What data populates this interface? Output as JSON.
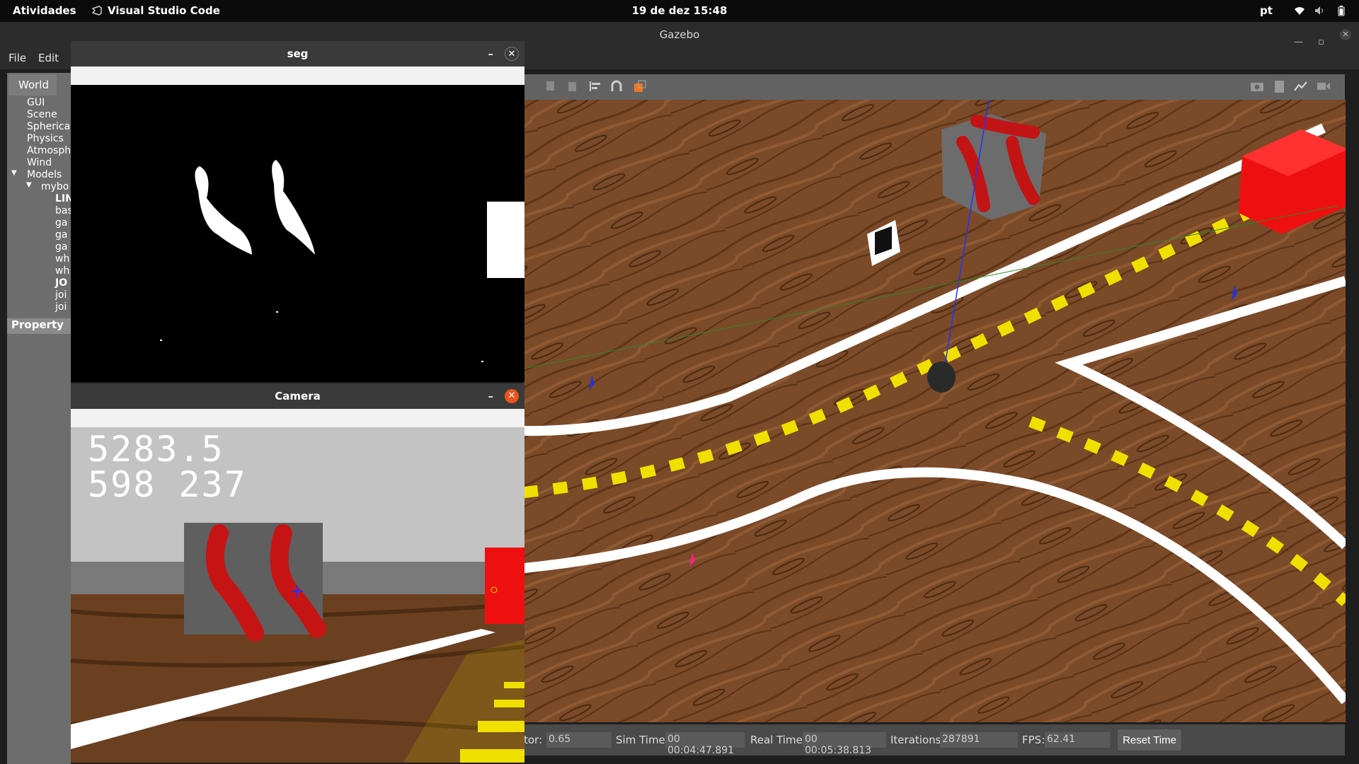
{
  "topbar": {
    "activities": "Atividades",
    "app_name": "Visual Studio Code",
    "clock": "19 de dez  15:48",
    "language": "pt",
    "icons": [
      "wifi-icon",
      "volume-icon",
      "battery-icon"
    ]
  },
  "gazebo": {
    "title": "Gazebo",
    "menu": [
      "File",
      "Edit"
    ],
    "left_panel": {
      "tab": "World",
      "tree": [
        "GUI",
        "Scene",
        "Spherical",
        "Physics",
        "Atmosph",
        "Wind",
        "Models",
        "mybo",
        "LIN",
        "bas",
        "ga",
        "ga",
        "ga",
        "wh",
        "wh",
        "JO",
        "joi",
        "joi"
      ],
      "property_header": "Property"
    },
    "status": {
      "factor_label": "tor:",
      "factor_value": "0.65",
      "sim_time_label": "Sim Time:",
      "sim_time_value": "00 00:04:47.891",
      "real_time_label": "Real Time:",
      "real_time_value": "00 00:05:38.813",
      "iterations_label": "Iterations:",
      "iterations_value": "287891",
      "fps_label": "FPS:",
      "fps_value": "62.41",
      "reset_label": "Reset Time"
    }
  },
  "seg_window": {
    "title": "seg",
    "minimize": "–",
    "close": "✕"
  },
  "camera_window": {
    "title": "Camera",
    "minimize": "–",
    "close": "✕",
    "overlay_line1": "5283.5",
    "overlay_line2": "598 237"
  }
}
